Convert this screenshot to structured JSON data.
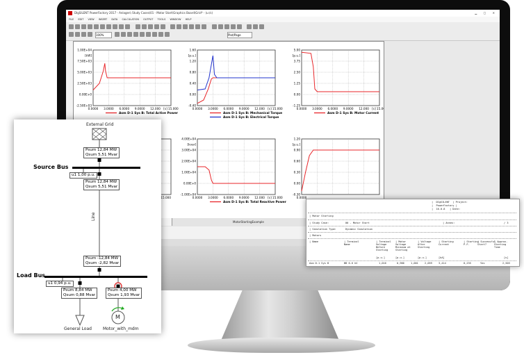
{
  "app": {
    "title": "DIgSILENT PowerFactory 2017 - Anlagen\\ Study Cases\\01 - Motor Start\\Graphics Board\\Grid* - (u:/s)",
    "menu": [
      "FILE",
      "EDIT",
      "VIEW",
      "INSERT",
      "DATA",
      "CALCULATION",
      "OUTPUT",
      "TOOLS",
      "WINDOW",
      "HELP"
    ],
    "zoom_value": "100%",
    "page_select": "Plot/Page",
    "tabs_label": "MotorStartingExample",
    "colors": {
      "red": "#e8262a",
      "blue": "#2233cc",
      "grid": "#9a9a9a"
    }
  },
  "plots": [
    {
      "yticks": [
        "1.00E+04",
        "7.50E+03",
        "5.00E+03",
        "2.50E+03",
        "0.00E+0",
        "-2.50E+03"
      ],
      "yunit": "[kW]",
      "xticks": [
        "0.0000",
        "3.0000",
        "6.0000",
        "9.0000",
        "12.000",
        "[s] 15.000"
      ],
      "legend": [
        {
          "label": "Asm D-1 Sys B: Total Active Power",
          "color": "red"
        }
      ]
    },
    {
      "yticks": [
        "1.60",
        "1.20",
        "0.80",
        "0.40",
        "0.00",
        "-0.40"
      ],
      "yunit": "[p.u.]",
      "xticks": [
        "0.0000",
        "3.0000",
        "6.0000",
        "9.0000",
        "12.000",
        "[s] 15.000"
      ],
      "legend": [
        {
          "label": "Asm D-1 Sys B: Mechanical Torque",
          "color": "red"
        },
        {
          "label": "Asm D-1 Sys B: Electrical Torque",
          "color": "blue"
        }
      ]
    },
    {
      "yticks": [
        "5.00",
        "3.75",
        "2.50",
        "1.25",
        "0.00",
        "-1.25"
      ],
      "yunit": "[p.u.]",
      "xticks": [
        "0.0000",
        "3.0000",
        "6.0000",
        "9.0000",
        "12.000",
        "[s] 15.000"
      ],
      "legend": [
        {
          "label": "Asm D-1 Sys B: Motor Current",
          "color": "red"
        }
      ]
    },
    {
      "yticks": [],
      "yunit": "",
      "xticks": [
        "[s] 15.000"
      ],
      "legend": []
    },
    {
      "yticks": [
        "4.00E+04",
        "3.00E+04",
        "2.00E+04",
        "1.00E+04",
        "0.00E+0",
        "-1.00E+04"
      ],
      "yunit": "[kvar]",
      "xticks": [
        "0.0000",
        "3.0000",
        "6.0000",
        "9.0000",
        "12.000",
        "[s] 15.000"
      ],
      "legend": [
        {
          "label": "Asm D-1 Sys B: Total Reactive Power",
          "color": "red"
        }
      ]
    },
    {
      "yticks": [
        "1.20",
        "0.90",
        "0.60",
        "0.30",
        "0.00",
        "-0.30"
      ],
      "yunit": "[p.u.]",
      "xticks": [
        "0.0000"
      ],
      "legend": []
    }
  ],
  "diagram": {
    "external_grid": "External Grid",
    "source_bus": "Source Bus",
    "load_bus": "Load Bus",
    "line": "Line",
    "general_load": "General Load",
    "motor_name": "Motor_with_mdm",
    "motor_symbol": "M",
    "boxes": {
      "grid_top": [
        "Psum 12,84 MW",
        "Qsum 5,51 Mvar"
      ],
      "source_u": "u1 1,00 p.u.",
      "source_below": [
        "Psum 12,84 MW",
        "Qsum 5,51 Mvar"
      ],
      "line_bottom": [
        "Psum -12,84 MW",
        "Qsum -2,82 Mvar"
      ],
      "load_u": "u1 0,94 p.u.",
      "load_left": [
        "Psum 8,84 MW",
        "Qsum 0,88 Mvar"
      ],
      "load_right": [
        "Psum 4,00 MW",
        "Qsum 1,93 Mvar"
      ]
    }
  },
  "report": {
    "header": [
      "|  DIgSILENT  | Project:",
      "|  PowerFactory |",
      "|  16.0.8   | Date:"
    ],
    "title": "| Motor Starting",
    "study_case_label": "| Study Case:",
    "study_case_value": "00 - Motor Start",
    "annex_label": "| Annex:",
    "annex_value": "/ 3",
    "sim_type_label": "| Simulation Type:",
    "sim_type_value": "Dynamic Simulation",
    "section": "| Motors",
    "columns": [
      "Name",
      "Terminal Name",
      "Terminal Voltage Before Starting",
      "Motor Voltage Minimum at Starting",
      "Voltage After Starting",
      "Starting Current",
      "Starting P.F.",
      "Successful Start?",
      "Approx. Starting Time"
    ],
    "units": [
      "[p.u.]",
      "[p.u.]",
      "[p.u.]",
      "[kA]",
      "",
      "",
      "[s]"
    ],
    "row": [
      "Asm D-1 Sys B",
      "BB 6.6 kV",
      "1,016",
      "0,986",
      "1,001",
      "2,059",
      "3,414",
      "0,235",
      "Yes",
      "2,503"
    ]
  }
}
